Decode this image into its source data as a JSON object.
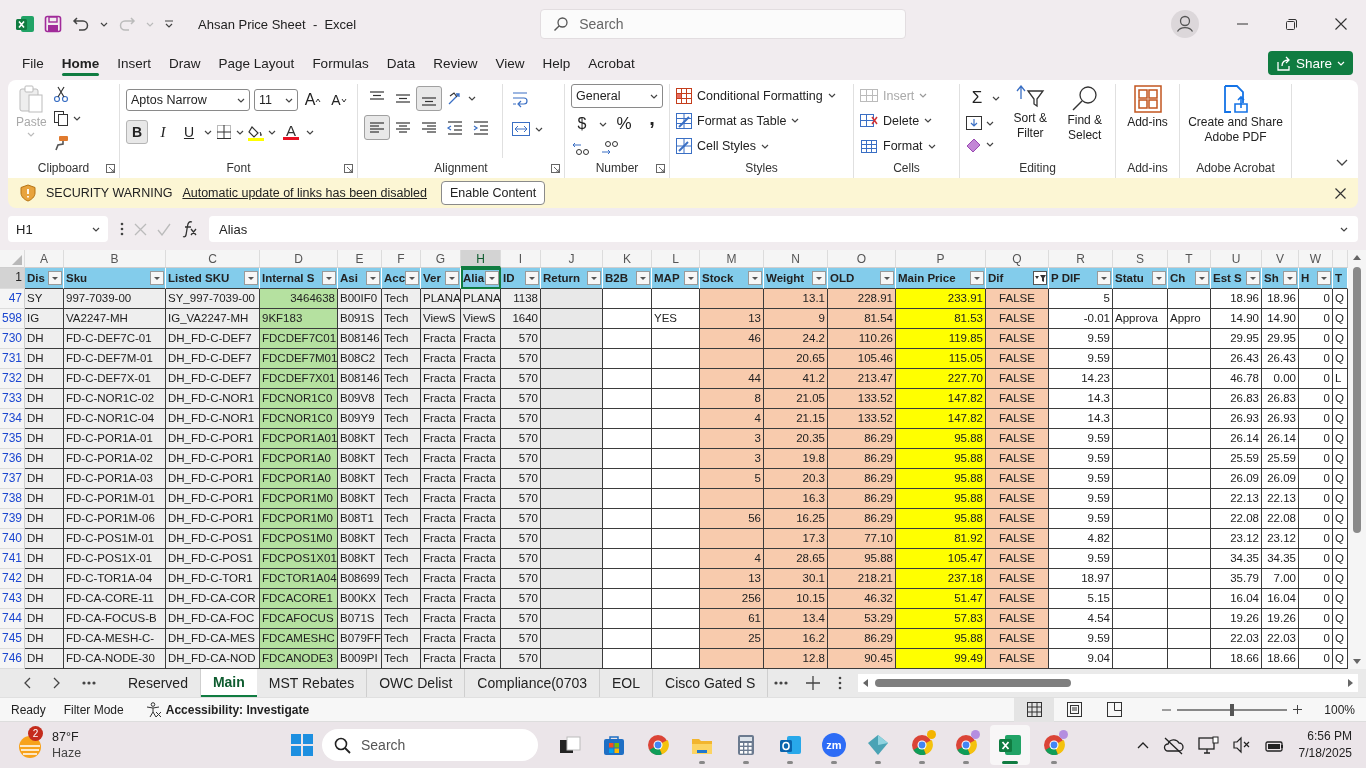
{
  "window": {
    "title": "Ahsan Price Sheet  -  Excel",
    "search": {
      "placeholder": "Search"
    },
    "redo_disabled": true
  },
  "menu": [
    {
      "label": "File",
      "selected": false
    },
    {
      "label": "Home",
      "selected": true
    },
    {
      "label": "Insert",
      "selected": false
    },
    {
      "label": "Draw",
      "selected": false
    },
    {
      "label": "Page Layout",
      "selected": false
    },
    {
      "label": "Formulas",
      "selected": false
    },
    {
      "label": "Data",
      "selected": false
    },
    {
      "label": "Review",
      "selected": false
    },
    {
      "label": "View",
      "selected": false
    },
    {
      "label": "Help",
      "selected": false
    },
    {
      "label": "Acrobat",
      "selected": false
    }
  ],
  "share": {
    "label": "Share"
  },
  "ribbon": {
    "clipboard": {
      "label": "Clipboard",
      "paste": {
        "label": "Paste",
        "disabled": true
      }
    },
    "font": {
      "label": "Font",
      "name": "Aptos Narrow",
      "size": "11",
      "grow": "A",
      "shrink": "A",
      "styles": [
        {
          "label": "B",
          "kind": "bold",
          "selected": true
        },
        {
          "label": "I",
          "kind": "italic",
          "selected": false
        },
        {
          "label": "U",
          "kind": "underline",
          "selected": false
        }
      ],
      "font_color": "A"
    },
    "alignment": {
      "label": "Alignment",
      "buttons": [
        {
          "kind": "top",
          "selected": false
        },
        {
          "kind": "middle",
          "selected": false
        },
        {
          "kind": "bottom",
          "selected": true
        },
        {
          "kind": "orientation",
          "selected": false
        },
        {
          "kind": "left",
          "selected": true
        },
        {
          "kind": "center",
          "selected": false
        },
        {
          "kind": "right",
          "selected": false
        },
        {
          "kind": "outdent",
          "selected": false
        },
        {
          "kind": "indent",
          "selected": false
        }
      ]
    },
    "number": {
      "label": "Number",
      "format": "General",
      "currency": "$",
      "percent": "%",
      "comma": ","
    },
    "styles": {
      "label": "Styles",
      "items": [
        {
          "label": "Conditional Formatting",
          "kind": "conditional"
        },
        {
          "label": "Format as Table",
          "kind": "table"
        },
        {
          "label": "Cell Styles",
          "kind": "styles"
        }
      ]
    },
    "cells": {
      "label": "Cells",
      "items": [
        {
          "label": "Insert",
          "kind": "insert",
          "disabled": true
        },
        {
          "label": "Delete",
          "kind": "delete",
          "disabled": false
        },
        {
          "label": "Format",
          "kind": "format",
          "disabled": false
        }
      ]
    },
    "editing": {
      "label": "Editing",
      "autosum": "Σ",
      "sort": "Sort & Filter",
      "find": "Find & Select"
    },
    "addins": {
      "label": "Add-ins",
      "button": "Add-ins"
    },
    "acrobat": {
      "label": "Adobe Acrobat",
      "button": "Create and Share Adobe PDF"
    }
  },
  "security": {
    "title": "SECURITY WARNING",
    "message": "Automatic update of links has been disabled",
    "button": "Enable Content"
  },
  "formula_bar": {
    "name_box": "H1",
    "value": "Alias"
  },
  "sheet": {
    "header_row": "1",
    "columns": [
      {
        "letter": "A",
        "header": "Dis",
        "color": "#eeeeee",
        "selected": false,
        "filtered": false
      },
      {
        "letter": "B",
        "header": "Sku",
        "color": "#eeeeee",
        "selected": false,
        "filtered": false
      },
      {
        "letter": "C",
        "header": "Listed SKU",
        "color": "#eeeeee",
        "selected": false,
        "filtered": false
      },
      {
        "letter": "D",
        "header": "Internal S",
        "color": "#b5e1a0",
        "selected": false,
        "filtered": false
      },
      {
        "letter": "E",
        "header": "Asi",
        "color": "#eeeeee",
        "selected": false,
        "filtered": false
      },
      {
        "letter": "F",
        "header": "Acc",
        "color": "#eeeeee",
        "selected": false,
        "filtered": false
      },
      {
        "letter": "G",
        "header": "Ver",
        "color": "#eeeeee",
        "selected": false,
        "filtered": false
      },
      {
        "letter": "H",
        "header": "Alia",
        "color": "#eeeeee",
        "selected": true,
        "filtered": false
      },
      {
        "letter": "I",
        "header": "ID",
        "color": "#eeeeee",
        "selected": false,
        "filtered": false
      },
      {
        "letter": "J",
        "header": "Return",
        "color": "#e8e8e8",
        "selected": false,
        "filtered": false
      },
      {
        "letter": "K",
        "header": "B2B",
        "color": "#ffffff",
        "selected": false,
        "filtered": false
      },
      {
        "letter": "L",
        "header": "MAP",
        "color": "#ffffff",
        "selected": false,
        "filtered": false
      },
      {
        "letter": "M",
        "header": "Stock",
        "color": "#f8cbad",
        "selected": false,
        "filtered": false
      },
      {
        "letter": "N",
        "header": "Weight",
        "color": "#f8cbad",
        "selected": false,
        "filtered": false
      },
      {
        "letter": "O",
        "header": "OLD",
        "color": "#f8cbad",
        "selected": false,
        "filtered": false
      },
      {
        "letter": "P",
        "header": "Main Price",
        "color": "#ffff00",
        "selected": false,
        "filtered": false
      },
      {
        "letter": "Q",
        "header": "Dif",
        "color": "#f8cbad",
        "selected": false,
        "filtered": true,
        "kind": "boolean"
      },
      {
        "letter": "R",
        "header": "P DIF",
        "color": "#ffffff",
        "selected": false,
        "filtered": false
      },
      {
        "letter": "S",
        "header": "Statu",
        "color": "#ffffff",
        "selected": false,
        "filtered": false
      },
      {
        "letter": "T",
        "header": "Ch",
        "color": "#ffffff",
        "selected": false,
        "filtered": false
      },
      {
        "letter": "U",
        "header": "Est S",
        "color": "#ffffff",
        "selected": false,
        "filtered": false
      },
      {
        "letter": "V",
        "header": "Sh",
        "color": "#ffffff",
        "selected": false,
        "filtered": false
      },
      {
        "letter": "W",
        "header": "H",
        "color": "#ffffff",
        "selected": false,
        "filtered": false
      },
      {
        "header": "T",
        "color": "#ffffff",
        "selected": false
      }
    ],
    "rows": [
      {
        "number": "47",
        "cells": [
          "SY",
          "997-7039-00",
          "SY_997-7039-00",
          "3464638",
          "B00IF0",
          "Tech",
          "PLANA",
          "PLANA",
          "1138",
          null,
          null,
          null,
          null,
          "13.1",
          "228.91",
          "233.91",
          "FALSE",
          "5",
          null,
          null,
          "18.96",
          "18.96",
          "0",
          "Q"
        ]
      },
      {
        "number": "598",
        "cells": [
          "IG",
          "VA2247-MH",
          "IG_VA2247-MH",
          "9KF183",
          "B091S",
          "Tech",
          "ViewS",
          "ViewS",
          "1640",
          null,
          null,
          "YES",
          "13",
          "9",
          "81.54",
          "81.53",
          "FALSE",
          "-0.01",
          "Approva",
          "Appro",
          "14.90",
          "14.90",
          "0",
          "Q"
        ]
      },
      {
        "number": "730",
        "cells": [
          "DH",
          "FD-C-DEF7C-01",
          "DH_FD-C-DEF7",
          "FDCDEF7C01",
          "B08146",
          "Tech",
          "Fracta",
          "Fracta",
          "570",
          null,
          null,
          null,
          "46",
          "24.2",
          "110.26",
          "119.85",
          "FALSE",
          "9.59",
          null,
          null,
          "29.95",
          "29.95",
          "0",
          "Q"
        ]
      },
      {
        "number": "731",
        "cells": [
          "DH",
          "FD-C-DEF7M-01",
          "DH_FD-C-DEF7",
          "FDCDEF7M01",
          "B08C2",
          "Tech",
          "Fracta",
          "Fracta",
          "570",
          null,
          null,
          null,
          null,
          "20.65",
          "105.46",
          "115.05",
          "FALSE",
          "9.59",
          null,
          null,
          "26.43",
          "26.43",
          "0",
          "Q"
        ]
      },
      {
        "number": "732",
        "cells": [
          "DH",
          "FD-C-DEF7X-01",
          "DH_FD-C-DEF7",
          "FDCDEF7X01",
          "B08146",
          "Tech",
          "Fracta",
          "Fracta",
          "570",
          null,
          null,
          null,
          "44",
          "41.2",
          "213.47",
          "227.70",
          "FALSE",
          "14.23",
          null,
          null,
          "46.78",
          "0.00",
          "0",
          "L"
        ]
      },
      {
        "number": "733",
        "cells": [
          "DH",
          "FD-C-NOR1C-02",
          "DH_FD-C-NOR1",
          "FDCNOR1C0",
          "B09V8",
          "Tech",
          "Fracta",
          "Fracta",
          "570",
          null,
          null,
          null,
          "8",
          "21.05",
          "133.52",
          "147.82",
          "FALSE",
          "14.3",
          null,
          null,
          "26.83",
          "26.83",
          "0",
          "Q"
        ]
      },
      {
        "number": "734",
        "cells": [
          "DH",
          "FD-C-NOR1C-04",
          "DH_FD-C-NOR1",
          "FDCNOR1C0",
          "B09Y9",
          "Tech",
          "Fracta",
          "Fracta",
          "570",
          null,
          null,
          null,
          "4",
          "21.15",
          "133.52",
          "147.82",
          "FALSE",
          "14.3",
          null,
          null,
          "26.93",
          "26.93",
          "0",
          "Q"
        ]
      },
      {
        "number": "735",
        "cells": [
          "DH",
          "FD-C-POR1A-01",
          "DH_FD-C-POR1",
          "FDCPOR1A01",
          "B08KT",
          "Tech",
          "Fracta",
          "Fracta",
          "570",
          null,
          null,
          null,
          "3",
          "20.35",
          "86.29",
          "95.88",
          "FALSE",
          "9.59",
          null,
          null,
          "26.14",
          "26.14",
          "0",
          "Q"
        ]
      },
      {
        "number": "736",
        "cells": [
          "DH",
          "FD-C-POR1A-02",
          "DH_FD-C-POR1",
          "FDCPOR1A0",
          "B08KT",
          "Tech",
          "Fracta",
          "Fracta",
          "570",
          null,
          null,
          null,
          "3",
          "19.8",
          "86.29",
          "95.88",
          "FALSE",
          "9.59",
          null,
          null,
          "25.59",
          "25.59",
          "0",
          "Q"
        ]
      },
      {
        "number": "737",
        "cells": [
          "DH",
          "FD-C-POR1A-03",
          "DH_FD-C-POR1",
          "FDCPOR1A0",
          "B08KT",
          "Tech",
          "Fracta",
          "Fracta",
          "570",
          null,
          null,
          null,
          "5",
          "20.3",
          "86.29",
          "95.88",
          "FALSE",
          "9.59",
          null,
          null,
          "26.09",
          "26.09",
          "0",
          "Q"
        ]
      },
      {
        "number": "738",
        "cells": [
          "DH",
          "FD-C-POR1M-01",
          "DH_FD-C-POR1",
          "FDCPOR1M0",
          "B08KT",
          "Tech",
          "Fracta",
          "Fracta",
          "570",
          null,
          null,
          null,
          null,
          "16.3",
          "86.29",
          "95.88",
          "FALSE",
          "9.59",
          null,
          null,
          "22.13",
          "22.13",
          "0",
          "Q"
        ]
      },
      {
        "number": "739",
        "cells": [
          "DH",
          "FD-C-POR1M-06",
          "DH_FD-C-POR1",
          "FDCPOR1M0",
          "B08T1",
          "Tech",
          "Fracta",
          "Fracta",
          "570",
          null,
          null,
          null,
          "56",
          "16.25",
          "86.29",
          "95.88",
          "FALSE",
          "9.59",
          null,
          null,
          "22.08",
          "22.08",
          "0",
          "Q"
        ]
      },
      {
        "number": "740",
        "cells": [
          "DH",
          "FD-C-POS1M-01",
          "DH_FD-C-POS1",
          "FDCPOS1M0",
          "B08KT",
          "Tech",
          "Fracta",
          "Fracta",
          "570",
          null,
          null,
          null,
          null,
          "17.3",
          "77.10",
          "81.92",
          "FALSE",
          "4.82",
          null,
          null,
          "23.12",
          "23.12",
          "0",
          "Q"
        ]
      },
      {
        "number": "741",
        "cells": [
          "DH",
          "FD-C-POS1X-01",
          "DH_FD-C-POS1",
          "FDCPOS1X01",
          "B08KT",
          "Tech",
          "Fracta",
          "Fracta",
          "570",
          null,
          null,
          null,
          "4",
          "28.65",
          "95.88",
          "105.47",
          "FALSE",
          "9.59",
          null,
          null,
          "34.35",
          "34.35",
          "0",
          "Q"
        ]
      },
      {
        "number": "742",
        "cells": [
          "DH",
          "FD-C-TOR1A-04",
          "DH_FD-C-TOR1",
          "FDCTOR1A04",
          "B08699",
          "Tech",
          "Fracta",
          "Fracta",
          "570",
          null,
          null,
          null,
          "13",
          "30.1",
          "218.21",
          "237.18",
          "FALSE",
          "18.97",
          null,
          null,
          "35.79",
          "7.00",
          "0",
          "Q"
        ]
      },
      {
        "number": "743",
        "cells": [
          "DH",
          "FD-CA-CORE-11",
          "DH_FD-CA-COR",
          "FDCACORE1",
          "B00KX",
          "Tech",
          "Fracta",
          "Fracta",
          "570",
          null,
          null,
          null,
          "256",
          "10.15",
          "46.32",
          "51.47",
          "FALSE",
          "5.15",
          null,
          null,
          "16.04",
          "16.04",
          "0",
          "Q"
        ]
      },
      {
        "number": "744",
        "cells": [
          "DH",
          "FD-CA-FOCUS-B",
          "DH_FD-CA-FOC",
          "FDCAFOCUS",
          "B071S",
          "Tech",
          "Fracta",
          "Fracta",
          "570",
          null,
          null,
          null,
          "61",
          "13.4",
          "53.29",
          "57.83",
          "FALSE",
          "4.54",
          null,
          null,
          "19.26",
          "19.26",
          "0",
          "Q"
        ]
      },
      {
        "number": "745",
        "cells": [
          "DH",
          "FD-CA-MESH-C-",
          "DH_FD-CA-MES",
          "FDCAMESHC",
          "B079FF",
          "Tech",
          "Fracta",
          "Fracta",
          "570",
          null,
          null,
          null,
          "25",
          "16.2",
          "86.29",
          "95.88",
          "FALSE",
          "9.59",
          null,
          null,
          "22.03",
          "22.03",
          "0",
          "Q"
        ]
      },
      {
        "number": "746",
        "cells": [
          "DH",
          "FD-CA-NODE-30",
          "DH_FD-CA-NOD",
          "FDCANODE3",
          "B009PI",
          "Tech",
          "Fracta",
          "Fracta",
          "570",
          null,
          null,
          null,
          null,
          "12.8",
          "90.45",
          "99.49",
          "FALSE",
          "9.04",
          null,
          null,
          "18.66",
          "18.66",
          "0",
          "Q"
        ]
      }
    ]
  },
  "sheet_tabs": [
    {
      "label": "Reserved",
      "selected": false
    },
    {
      "label": "Main",
      "selected": true
    },
    {
      "label": "MST Rebates",
      "selected": false
    },
    {
      "label": "OWC Delist",
      "selected": false
    },
    {
      "label": "Compliance(0703",
      "selected": false
    },
    {
      "label": "EOL",
      "selected": false
    },
    {
      "label": "Cisco Gated S",
      "selected": false
    }
  ],
  "status_bar": {
    "items": [
      "Ready",
      "Filter Mode"
    ],
    "accessibility": "Accessibility: Investigate",
    "views": [
      {
        "kind": "normal",
        "selected": true
      },
      {
        "kind": "page_layout",
        "selected": false
      },
      {
        "kind": "page_break",
        "selected": false
      }
    ],
    "zoom": {
      "level": 0.5,
      "label": "100%"
    }
  },
  "taskbar": {
    "weather": {
      "badge": "2",
      "temperature": "87°F",
      "condition": "Haze"
    },
    "search": {
      "placeholder": "Search"
    },
    "apps": [
      {
        "kind": "taskview",
        "selected": false,
        "running": false
      },
      {
        "kind": "store",
        "selected": false,
        "running": false
      },
      {
        "kind": "chrome",
        "selected": false,
        "running": false
      },
      {
        "kind": "explorer",
        "selected": false,
        "running": true
      },
      {
        "kind": "calculator",
        "selected": false,
        "running": true
      },
      {
        "kind": "outlook",
        "selected": false,
        "running": true
      },
      {
        "kind": "zoom",
        "label": "zm",
        "selected": false,
        "running": true
      },
      {
        "kind": "generic",
        "selected": false,
        "running": true
      },
      {
        "kind": "chrome",
        "color": "#f4b400",
        "selected": false,
        "running": true
      },
      {
        "kind": "chrome",
        "color": "#b48ee0",
        "selected": false,
        "running": true
      },
      {
        "kind": "excel",
        "selected": true,
        "running": true
      },
      {
        "kind": "chrome",
        "color": "#b48ee0",
        "selected": false,
        "running": true
      }
    ],
    "clock": {
      "time": "6:56 PM",
      "date": "7/18/2025"
    }
  }
}
